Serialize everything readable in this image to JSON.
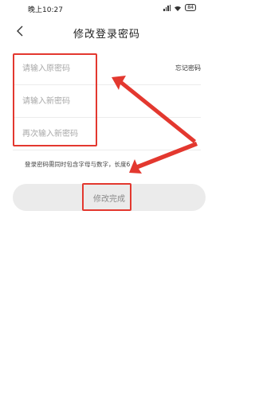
{
  "status_bar": {
    "time": "晚上10:27",
    "battery": "84"
  },
  "header": {
    "title": "修改登录密码"
  },
  "form": {
    "old_password_placeholder": "请输入原密码",
    "new_password_placeholder": "请输入新密码",
    "confirm_password_placeholder": "再次输入新密码",
    "forgot_label": "忘记密码"
  },
  "hint": "登录密码需同时包含字母与数字，长度6",
  "submit_label": "修改完成",
  "colors": {
    "annotation": "#e3382f",
    "button_bg": "#ebebeb"
  }
}
